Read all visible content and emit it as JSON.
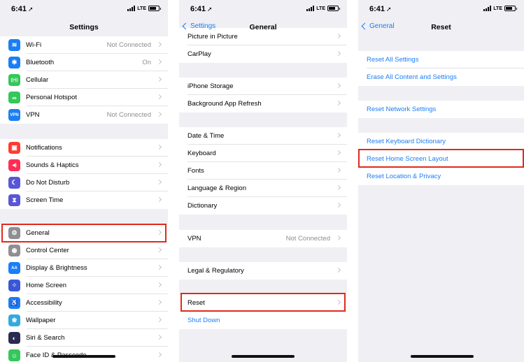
{
  "status_time": "6:41",
  "status_network": "LTE",
  "colors": {
    "accent": "#1a7ef7",
    "highlight": "#e0291d"
  },
  "screen1": {
    "title": "Settings",
    "rows": [
      {
        "label": "Wi-Fi",
        "value": "Not Connected",
        "icon": "wifi-icon",
        "icon_color": "#1a7ef7",
        "glyph": "≋"
      },
      {
        "label": "Bluetooth",
        "value": "On",
        "icon": "bluetooth-icon",
        "icon_color": "#1a7ef7",
        "glyph": "✱"
      },
      {
        "label": "Cellular",
        "value": "",
        "icon": "cellular-icon",
        "icon_color": "#34c759",
        "glyph": "((•))"
      },
      {
        "label": "Personal Hotspot",
        "value": "",
        "icon": "hotspot-icon",
        "icon_color": "#34c759",
        "glyph": "∞"
      },
      {
        "label": "VPN",
        "value": "Not Connected",
        "icon": "vpn-icon",
        "icon_color": "#1a7ef7",
        "glyph": "VPN"
      },
      {
        "label": "Notifications",
        "value": "",
        "icon": "notifications-icon",
        "icon_color": "#ff3b30",
        "glyph": "▣"
      },
      {
        "label": "Sounds & Haptics",
        "value": "",
        "icon": "sounds-icon",
        "icon_color": "#ff2d55",
        "glyph": "◀)"
      },
      {
        "label": "Do Not Disturb",
        "value": "",
        "icon": "moon-icon",
        "icon_color": "#5856d6",
        "glyph": "☾"
      },
      {
        "label": "Screen Time",
        "value": "",
        "icon": "hourglass-icon",
        "icon_color": "#5856d6",
        "glyph": "⧗"
      },
      {
        "label": "General",
        "value": "",
        "icon": "gear-icon",
        "icon_color": "#8e8e93",
        "glyph": "⚙"
      },
      {
        "label": "Control Center",
        "value": "",
        "icon": "control-center-icon",
        "icon_color": "#8e8e93",
        "glyph": "◉"
      },
      {
        "label": "Display & Brightness",
        "value": "",
        "icon": "display-icon",
        "icon_color": "#1a7ef7",
        "glyph": "AA"
      },
      {
        "label": "Home Screen",
        "value": "",
        "icon": "home-screen-icon",
        "icon_color": "#3a57d8",
        "glyph": "⁘"
      },
      {
        "label": "Accessibility",
        "value": "",
        "icon": "accessibility-icon",
        "icon_color": "#1a7ef7",
        "glyph": "♿"
      },
      {
        "label": "Wallpaper",
        "value": "",
        "icon": "wallpaper-icon",
        "icon_color": "#34aadc",
        "glyph": "❀"
      },
      {
        "label": "Siri & Search",
        "value": "",
        "icon": "siri-icon",
        "icon_color": "#2b2b50",
        "glyph": "◐"
      },
      {
        "label": "Face ID & Passcode",
        "value": "",
        "icon": "faceid-icon",
        "icon_color": "#34c759",
        "glyph": "☺"
      }
    ]
  },
  "screen2": {
    "back_label": "Settings",
    "title": "General",
    "rows": [
      {
        "label": "Picture in Picture",
        "value": ""
      },
      {
        "label": "CarPlay",
        "value": ""
      },
      {
        "label": "iPhone Storage",
        "value": ""
      },
      {
        "label": "Background App Refresh",
        "value": ""
      },
      {
        "label": "Date & Time",
        "value": ""
      },
      {
        "label": "Keyboard",
        "value": ""
      },
      {
        "label": "Fonts",
        "value": ""
      },
      {
        "label": "Language & Region",
        "value": ""
      },
      {
        "label": "Dictionary",
        "value": ""
      },
      {
        "label": "VPN",
        "value": "Not Connected"
      },
      {
        "label": "Legal & Regulatory",
        "value": ""
      },
      {
        "label": "Reset",
        "value": ""
      },
      {
        "label": "Shut Down",
        "value": ""
      }
    ]
  },
  "screen3": {
    "back_label": "General",
    "title": "Reset",
    "rows": [
      {
        "label": "Reset All Settings"
      },
      {
        "label": "Erase All Content and Settings"
      },
      {
        "label": "Reset Network Settings"
      },
      {
        "label": "Reset Keyboard Dictionary"
      },
      {
        "label": "Reset Home Screen Layout"
      },
      {
        "label": "Reset Location & Privacy"
      }
    ]
  }
}
